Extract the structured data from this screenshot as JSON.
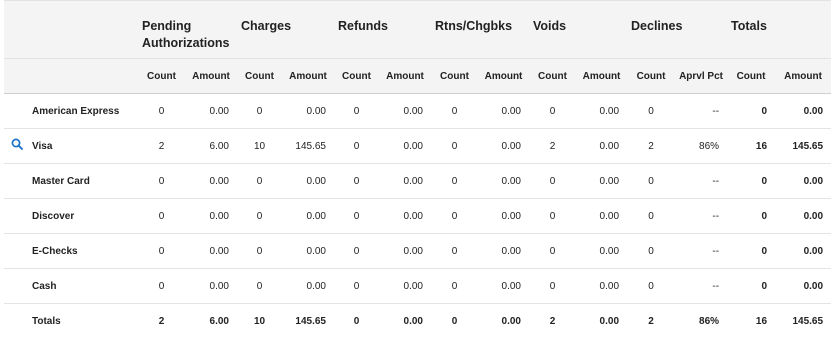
{
  "groups": {
    "pending": "Pending Authorizations",
    "charges": "Charges",
    "refunds": "Refunds",
    "rtns": "Rtns/Chgbks",
    "voids": "Voids",
    "declines": "Declines",
    "totals": "Totals"
  },
  "subheaders": {
    "count": "Count",
    "amount": "Amount",
    "aprvl_pct": "Aprvl Pct"
  },
  "rows": [
    {
      "name": "American Express",
      "pend_count": "0",
      "pend_amount": "0.00",
      "chg_count": "0",
      "chg_amount": "0.00",
      "ref_count": "0",
      "ref_amount": "0.00",
      "rtn_count": "0",
      "rtn_amount": "0.00",
      "void_count": "0",
      "void_amount": "0.00",
      "dec_count": "0",
      "aprvl_pct": "--",
      "tot_count": "0",
      "tot_amount": "0.00"
    },
    {
      "name": "Visa",
      "pend_count": "2",
      "pend_amount": "6.00",
      "chg_count": "10",
      "chg_amount": "145.65",
      "ref_count": "0",
      "ref_amount": "0.00",
      "rtn_count": "0",
      "rtn_amount": "0.00",
      "void_count": "2",
      "void_amount": "0.00",
      "dec_count": "2",
      "aprvl_pct": "86%",
      "tot_count": "16",
      "tot_amount": "145.65"
    },
    {
      "name": "Master Card",
      "pend_count": "0",
      "pend_amount": "0.00",
      "chg_count": "0",
      "chg_amount": "0.00",
      "ref_count": "0",
      "ref_amount": "0.00",
      "rtn_count": "0",
      "rtn_amount": "0.00",
      "void_count": "0",
      "void_amount": "0.00",
      "dec_count": "0",
      "aprvl_pct": "--",
      "tot_count": "0",
      "tot_amount": "0.00"
    },
    {
      "name": "Discover",
      "pend_count": "0",
      "pend_amount": "0.00",
      "chg_count": "0",
      "chg_amount": "0.00",
      "ref_count": "0",
      "ref_amount": "0.00",
      "rtn_count": "0",
      "rtn_amount": "0.00",
      "void_count": "0",
      "void_amount": "0.00",
      "dec_count": "0",
      "aprvl_pct": "--",
      "tot_count": "0",
      "tot_amount": "0.00"
    },
    {
      "name": "E-Checks",
      "pend_count": "0",
      "pend_amount": "0.00",
      "chg_count": "0",
      "chg_amount": "0.00",
      "ref_count": "0",
      "ref_amount": "0.00",
      "rtn_count": "0",
      "rtn_amount": "0.00",
      "void_count": "0",
      "void_amount": "0.00",
      "dec_count": "0",
      "aprvl_pct": "--",
      "tot_count": "0",
      "tot_amount": "0.00"
    },
    {
      "name": "Cash",
      "pend_count": "0",
      "pend_amount": "0.00",
      "chg_count": "0",
      "chg_amount": "0.00",
      "ref_count": "0",
      "ref_amount": "0.00",
      "rtn_count": "0",
      "rtn_amount": "0.00",
      "void_count": "0",
      "void_amount": "0.00",
      "dec_count": "0",
      "aprvl_pct": "--",
      "tot_count": "0",
      "tot_amount": "0.00"
    }
  ],
  "totals": {
    "name": "Totals",
    "pend_count": "2",
    "pend_amount": "6.00",
    "chg_count": "10",
    "chg_amount": "145.65",
    "ref_count": "0",
    "ref_amount": "0.00",
    "rtn_count": "0",
    "rtn_amount": "0.00",
    "void_count": "2",
    "void_amount": "0.00",
    "dec_count": "2",
    "aprvl_pct": "86%",
    "tot_count": "16",
    "tot_amount": "145.65"
  },
  "icons": {
    "details": "search-icon"
  },
  "colors": {
    "header_bg": "#f4f4f4",
    "icon": "#1a73c7",
    "border": "#e4e4e4"
  }
}
